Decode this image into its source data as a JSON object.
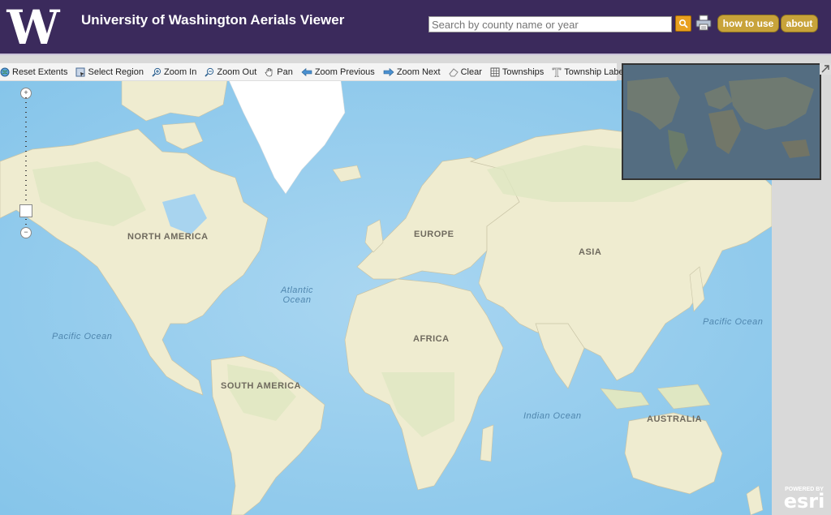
{
  "header": {
    "title": "University of Washington Aerials Viewer",
    "logo_letter": "W",
    "search_placeholder": "Search by county name or year",
    "how_to_use_label": "how to use",
    "about_label": "about"
  },
  "toolbar": {
    "tools": [
      {
        "label": "Reset Extents",
        "icon": "globe-icon"
      },
      {
        "label": "Select Region",
        "icon": "select-region-icon"
      },
      {
        "label": "Zoom In",
        "icon": "zoom-in-icon"
      },
      {
        "label": "Zoom Out",
        "icon": "zoom-out-icon"
      },
      {
        "label": "Pan",
        "icon": "hand-icon"
      },
      {
        "label": "Zoom Previous",
        "icon": "arrow-left-icon"
      },
      {
        "label": "Zoom Next",
        "icon": "arrow-right-icon"
      },
      {
        "label": "Clear",
        "icon": "eraser-icon"
      },
      {
        "label": "Townships",
        "icon": "grid-icon"
      },
      {
        "label": "Township Labels",
        "icon": "text-icon"
      }
    ]
  },
  "map": {
    "continent_labels": {
      "north_america": "NORTH AMERICA",
      "europe": "EUROPE",
      "asia": "ASIA",
      "africa": "AFRICA",
      "south_america": "SOUTH AMERICA",
      "australia": "AUSTRALIA"
    },
    "ocean_labels": {
      "atlantic_line1": "Atlantic",
      "atlantic_line2": "Ocean",
      "pacific_west": "Pacific Ocean",
      "pacific_east": "Pacific Ocean",
      "indian": "Indian Ocean"
    },
    "colors": {
      "ocean": "#a8d4ef",
      "ocean_deep": "#7fc1e8",
      "land": "#efecd0",
      "land_green": "#dfe7c2",
      "ice": "#ffffff"
    }
  },
  "attribution": {
    "powered_by": "POWERED BY",
    "brand": "esri"
  },
  "colors": {
    "header_bg": "#3b2a5c",
    "button_gold": "#c8a33a",
    "search_orange": "#e8a020"
  }
}
